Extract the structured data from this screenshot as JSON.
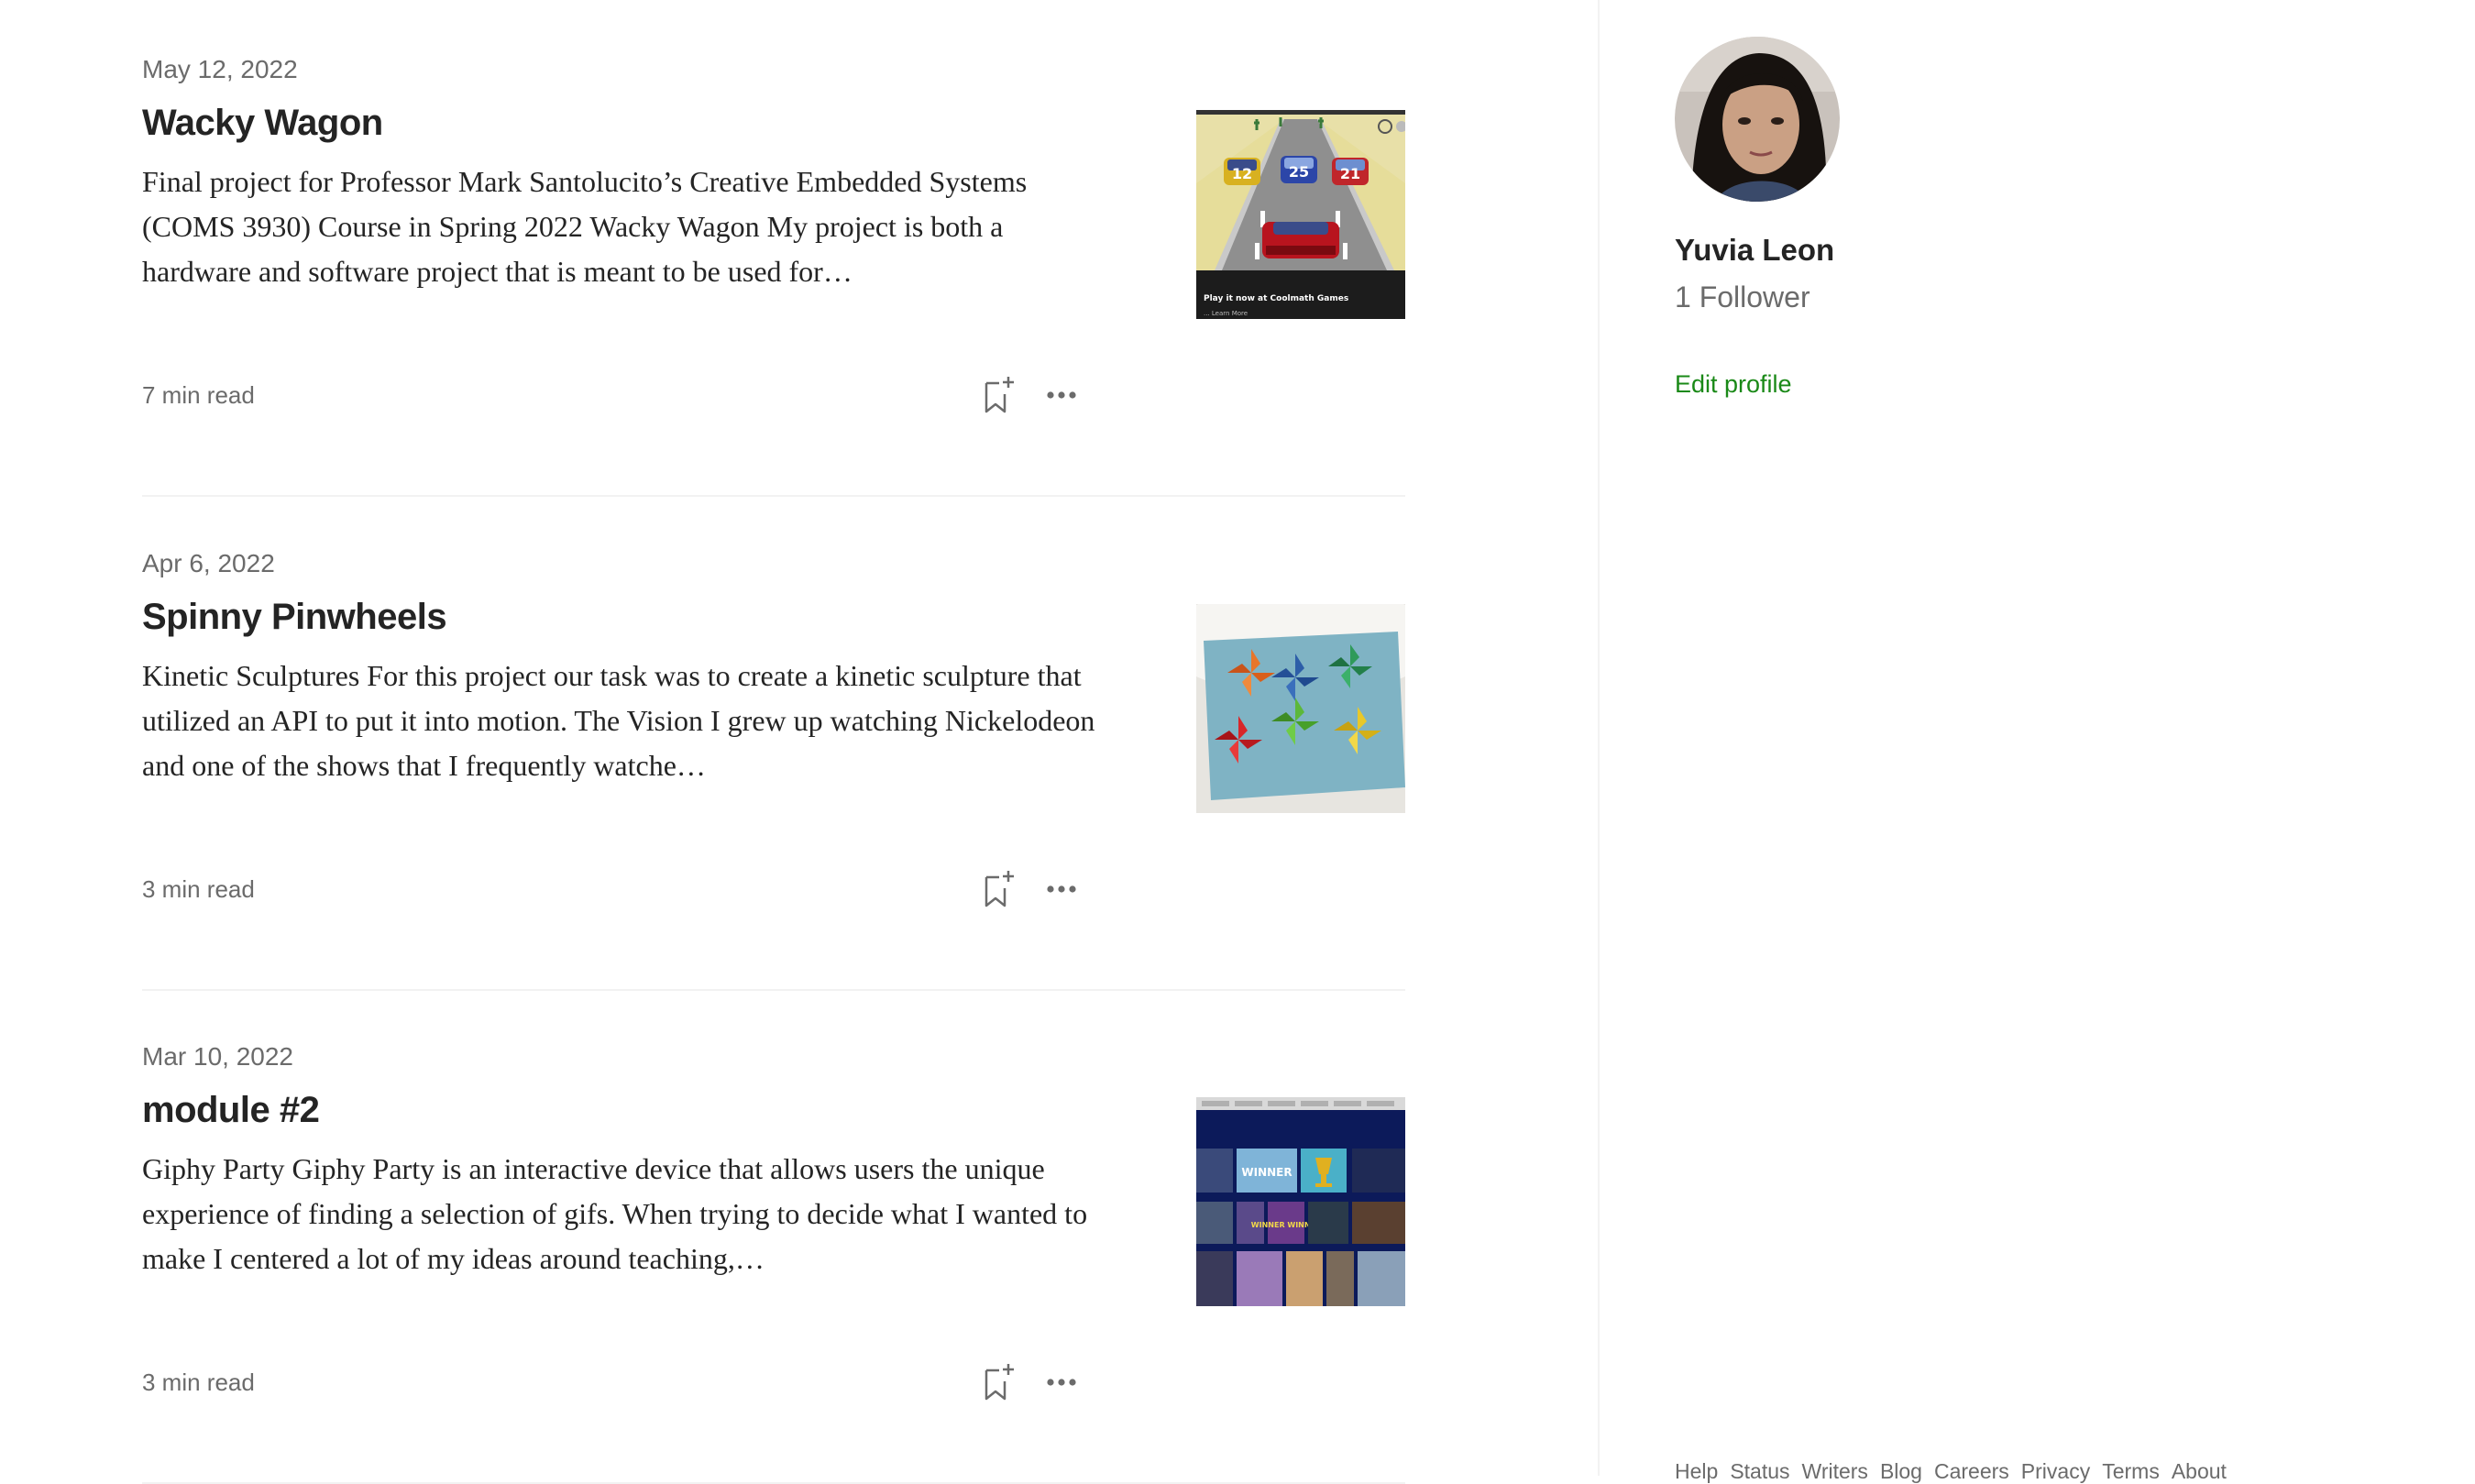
{
  "articles": [
    {
      "date": "May 12, 2022",
      "title": "Wacky Wagon",
      "excerpt": "Final project for Professor Mark Santolucito’s Creative Embedded Systems (COMS 3930) Course in Spring 2022 Wacky Wagon My project is both a hardware and software project that is meant to be used for…",
      "read_time": "7 min read",
      "thumb_caption": "Play it now at Coolmath Games",
      "thumb_note": "... Learn More",
      "car_numbers": [
        "12",
        "25",
        "21"
      ]
    },
    {
      "date": "Apr 6, 2022",
      "title": "Spinny Pinwheels",
      "excerpt": "Kinetic Sculptures For this project our task was to create a kinetic sculpture that utilized an API to put it into motion. The Vision I grew up watching Nickelodeon and one of the shows that I frequently watche…",
      "read_time": "3 min read"
    },
    {
      "date": "Mar 10, 2022",
      "title": "module #2",
      "excerpt": "Giphy Party Giphy Party is an interactive device that allows users the unique experience of finding a selection of gifs. When trying to decide what I wanted to make I centered a lot of my ideas around teaching,…",
      "read_time": "3 min read",
      "thumb_words": [
        "WINNER",
        "WINNER WINNER"
      ]
    }
  ],
  "profile": {
    "name": "Yuvia Leon",
    "followers": "1 Follower",
    "edit_label": "Edit profile"
  },
  "footer": [
    "Help",
    "Status",
    "Writers",
    "Blog",
    "Careers",
    "Privacy",
    "Terms",
    "About"
  ],
  "icons": {
    "save": "bookmark-add-icon",
    "more": "more-horizontal-icon"
  },
  "colors": {
    "text": "#242424",
    "muted": "#6b6b6b",
    "accent": "#1a8917",
    "divider": "#f2f2f2"
  }
}
